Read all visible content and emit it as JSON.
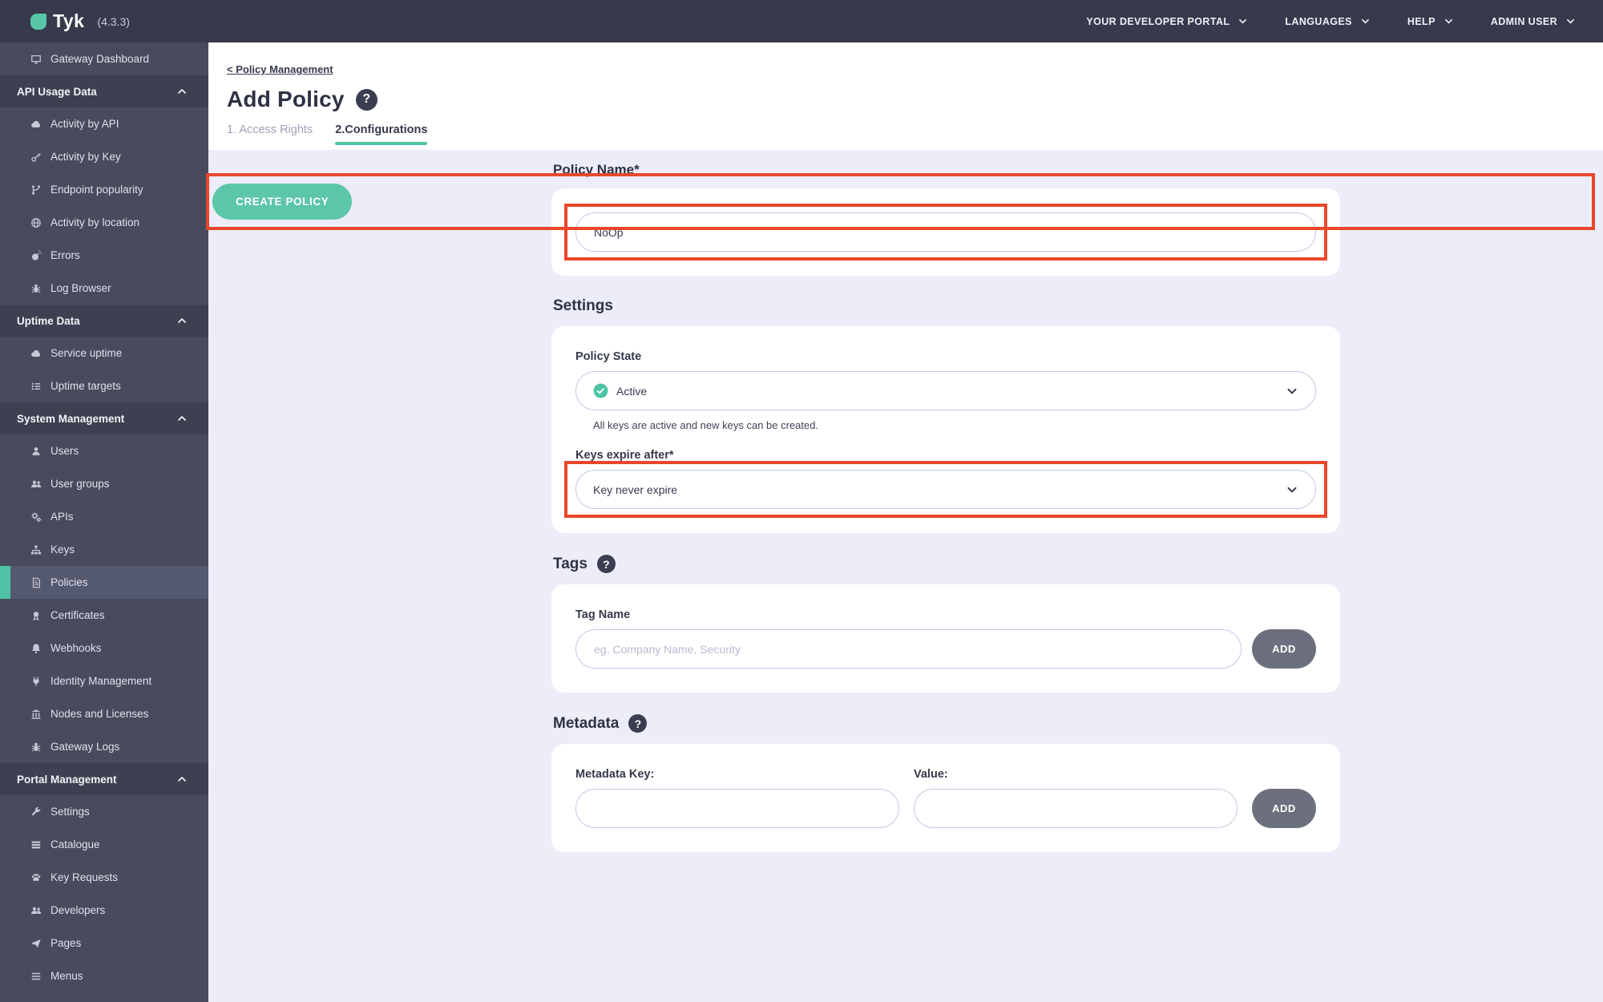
{
  "topbar": {
    "brand": "Tyk",
    "version": "(4.3.3)",
    "menus": [
      "YOUR DEVELOPER PORTAL",
      "LANGUAGES",
      "HELP",
      "ADMIN USER"
    ]
  },
  "sidebar": {
    "dashboard_item": {
      "label": "Gateway Dashboard",
      "icon": "monitor-icon"
    },
    "sections": [
      {
        "header": "API Usage Data",
        "items": [
          {
            "label": "Activity by API",
            "icon": "cloud-icon"
          },
          {
            "label": "Activity by Key",
            "icon": "key-icon"
          },
          {
            "label": "Endpoint popularity",
            "icon": "branch-icon"
          },
          {
            "label": "Activity by location",
            "icon": "globe-icon"
          },
          {
            "label": "Errors",
            "icon": "bomb-icon"
          },
          {
            "label": "Log Browser",
            "icon": "bug-icon"
          }
        ]
      },
      {
        "header": "Uptime Data",
        "items": [
          {
            "label": "Service uptime",
            "icon": "cloud-icon"
          },
          {
            "label": "Uptime targets",
            "icon": "list-icon"
          }
        ]
      },
      {
        "header": "System Management",
        "items": [
          {
            "label": "Users",
            "icon": "user-icon"
          },
          {
            "label": "User groups",
            "icon": "users-icon"
          },
          {
            "label": "APIs",
            "icon": "gears-icon"
          },
          {
            "label": "Keys",
            "icon": "sitemap-icon"
          },
          {
            "label": "Policies",
            "icon": "policy-icon",
            "active": true
          },
          {
            "label": "Certificates",
            "icon": "certificate-icon"
          },
          {
            "label": "Webhooks",
            "icon": "bell-icon"
          },
          {
            "label": "Identity Management",
            "icon": "plug-icon"
          },
          {
            "label": "Nodes and Licenses",
            "icon": "bank-icon"
          },
          {
            "label": "Gateway Logs",
            "icon": "bug-icon"
          }
        ]
      },
      {
        "header": "Portal Management",
        "items": [
          {
            "label": "Settings",
            "icon": "wrench-icon"
          },
          {
            "label": "Catalogue",
            "icon": "stack-icon"
          },
          {
            "label": "Key Requests",
            "icon": "paw-icon"
          },
          {
            "label": "Developers",
            "icon": "users-icon"
          },
          {
            "label": "Pages",
            "icon": "paper-plane-icon"
          },
          {
            "label": "Menus",
            "icon": "menu-bars-icon"
          }
        ]
      }
    ]
  },
  "main": {
    "breadcrumb": "< Policy Management",
    "title": "Add Policy",
    "tabs": [
      {
        "label": "1. Access Rights",
        "active": false
      },
      {
        "label": "2.Configurations",
        "active": true
      }
    ],
    "create_button": "CREATE POLICY",
    "policy_name": {
      "label": "Policy Name*",
      "value": "NoOp"
    },
    "settings": {
      "heading": "Settings",
      "policy_state": {
        "label": "Policy State",
        "value": "Active",
        "helper": "All keys are active and new keys can be created."
      },
      "keys_expire": {
        "label": "Keys expire after*",
        "value": "Key never expire"
      }
    },
    "tags": {
      "heading": "Tags",
      "tag_name_label": "Tag Name",
      "placeholder": "eg. Company Name, Security",
      "add_label": "ADD"
    },
    "metadata": {
      "heading": "Metadata",
      "key_label": "Metadata Key:",
      "value_label": "Value:",
      "add_label": "ADD"
    }
  },
  "icons": {
    "help_glyph": "?"
  },
  "colors": {
    "accent_teal": "#4cc6a5",
    "button_teal": "#5cc6a8",
    "annotation_red": "#e8472c",
    "topbar_bg": "#363a4c",
    "sidebar_bg": "#474b5d",
    "sidebar_section_bg": "#3c4050",
    "content_bg": "#ecedf8",
    "add_button_gray": "#6c6f7e"
  }
}
